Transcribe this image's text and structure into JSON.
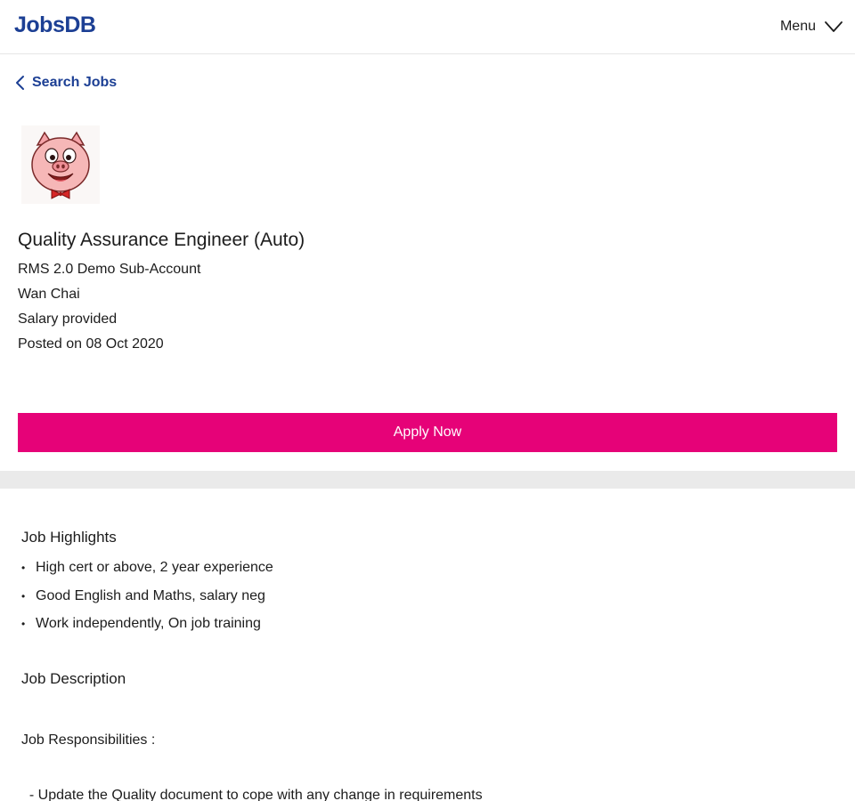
{
  "header": {
    "logo_text": "JobsDB",
    "menu_label": "Menu"
  },
  "nav": {
    "back_label": "Search Jobs"
  },
  "job": {
    "title": "Quality Assurance Engineer (Auto)",
    "company": "RMS 2.0 Demo Sub-Account",
    "location": "Wan Chai",
    "salary": "Salary provided",
    "posted": "Posted on 08 Oct 2020",
    "apply_label": "Apply Now"
  },
  "highlights": {
    "title": "Job Highlights",
    "items": [
      "High cert or above, 2 year experience",
      "Good English and Maths, salary neg",
      "Work independently, On job training"
    ]
  },
  "description": {
    "title": "Job Description",
    "responsibilities_label": "Job Responsibilities :",
    "lines": [
      "  - Update the Quality document to cope with any change in requirements"
    ]
  },
  "colors": {
    "brand": "#1c3f94",
    "apply": "#e60278",
    "divider": "#eaeaea"
  },
  "icons": {
    "menu": "chevron-down-icon",
    "back": "chevron-left-icon",
    "company_logo": "pig-mascot-logo"
  }
}
